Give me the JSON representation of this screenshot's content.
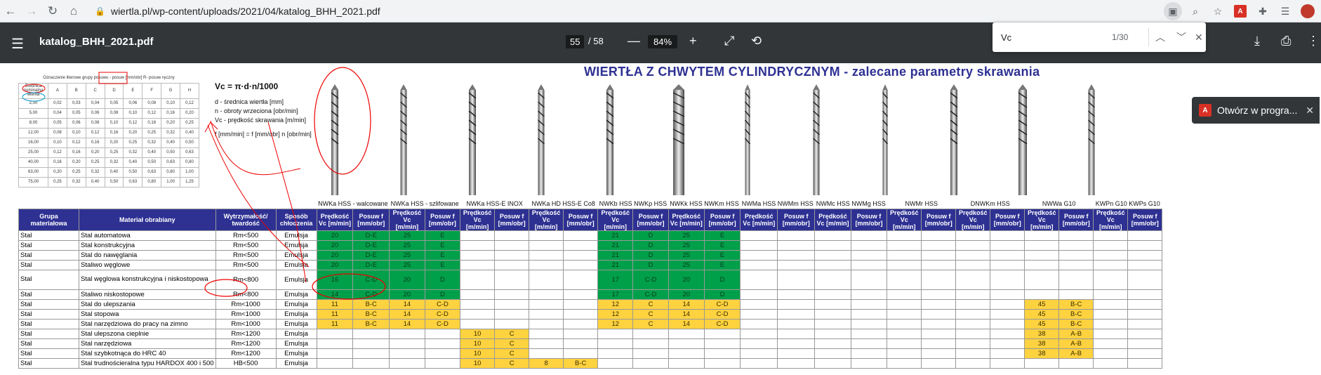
{
  "browser": {
    "url_host": "wiertla.pl",
    "url_path": "/wp-content/uploads/2021/04/katalog_BHH_2021.pdf"
  },
  "viewer": {
    "file_name": "katalog_BHH_2021.pdf",
    "page_current": "55",
    "page_total": "/ 58",
    "zoom": "84%"
  },
  "find": {
    "query": "Vc",
    "count": "1/30"
  },
  "popup": {
    "label": "Otwórz w progra..."
  },
  "doc": {
    "title": "WIERTŁA Z CHWYTEM CYLINDRYCZNYM - zalecane parametry skrawania",
    "mini_table": {
      "caption": "Oznaczenie literowe grupy posuwu - posuw [mm/obr] R- posuw ręczny",
      "head": [
        "Średnica nominalna wiertła",
        "A",
        "B",
        "C",
        "D",
        "E",
        "F",
        "G",
        "H"
      ],
      "rows": [
        [
          "2,00",
          "0,02",
          "0,03",
          "0,04",
          "0,05",
          "0,06",
          "0,08",
          "0,10",
          "0,12"
        ],
        [
          "5,00",
          "0,04",
          "0,05",
          "0,06",
          "0,08",
          "0,10",
          "0,12",
          "0,16",
          "0,20"
        ],
        [
          "8,00",
          "0,05",
          "0,06",
          "0,08",
          "0,10",
          "0,12",
          "0,16",
          "0,20",
          "0,25"
        ],
        [
          "12,00",
          "0,08",
          "0,10",
          "0,12",
          "0,16",
          "0,20",
          "0,25",
          "0,32",
          "0,40"
        ],
        [
          "16,00",
          "0,10",
          "0,12",
          "0,16",
          "0,20",
          "0,25",
          "0,32",
          "0,40",
          "0,50"
        ],
        [
          "25,00",
          "0,12",
          "0,16",
          "0,20",
          "0,25",
          "0,32",
          "0,40",
          "0,50",
          "0,63"
        ],
        [
          "40,00",
          "0,16",
          "0,20",
          "0,25",
          "0,32",
          "0,40",
          "0,50",
          "0,63",
          "0,80"
        ],
        [
          "63,00",
          "0,20",
          "0,25",
          "0,32",
          "0,40",
          "0,50",
          "0,63",
          "0,80",
          "1,00"
        ],
        [
          "75,00",
          "0,25",
          "0,32",
          "0,40",
          "0,50",
          "0,63",
          "0,80",
          "1,00",
          "1,25"
        ]
      ]
    },
    "formula": {
      "main": "Vc = π·d·n/1000",
      "d": "d - średnica wiertła [mm]",
      "n": "n - obroty wrzeciona [obr/min]",
      "vc": "Vc - prędkość skrawania [m/min]",
      "f": "f [mm/min] = f [mm/obr] n [obr/min]"
    },
    "groups": [
      "NWKa HSS - walcowane",
      "NWKa HSS - szlifowane",
      "NWKa HSS-E INOX",
      "NWKa HD HSS-E Co8",
      "NWKb HSS NWKp HSS",
      "NWKk HSS NWKm HSS",
      "NWMa HSS NWMm HSS",
      "NWMc HSS NWMg HSS",
      "NWMr HSS",
      "DNWKm HSS",
      "NWWa G10",
      "KWPn G10 KWPs G10"
    ],
    "colors": {
      "green": "#00a04a",
      "yellow": "#ffd23f",
      "header": "#2e3192"
    },
    "table": {
      "head": [
        "Grupa materiałowa",
        "Materiał obrabiany",
        "Wytrzymałość/ twardość",
        "Sposób chłodzenia"
      ],
      "v_head": "Prędkość Vc [m/min]",
      "f_head": "Posuw f [mm/obr]",
      "rows": [
        {
          "g": "Stal",
          "m": "Stal automatowa",
          "w": "Rm<500",
          "s": "Emulsja",
          "c": {
            "0": [
              "20",
              "D-E"
            ],
            "1": [
              "25",
              "E"
            ],
            "4": [
              "21",
              "D"
            ],
            "5": [
              "25",
              "E"
            ]
          },
          "col": "g"
        },
        {
          "g": "Stal",
          "m": "Stal konstrukcyjna",
          "w": "Rm<500",
          "s": "Emulsja",
          "c": {
            "0": [
              "20",
              "D-E"
            ],
            "1": [
              "25",
              "E"
            ],
            "4": [
              "21",
              "D"
            ],
            "5": [
              "25",
              "E"
            ]
          },
          "col": "g"
        },
        {
          "g": "Stal",
          "m": "Stal do nawęglania",
          "w": "Rm<500",
          "s": "Emulsja",
          "c": {
            "0": [
              "20",
              "D-E"
            ],
            "1": [
              "25",
              "E"
            ],
            "4": [
              "21",
              "D"
            ],
            "5": [
              "25",
              "E"
            ]
          },
          "col": "g"
        },
        {
          "g": "Stal",
          "m": "Staliwo węglowe",
          "w": "Rm<500",
          "s": "Emulsja",
          "c": {
            "0": [
              "20",
              "D-E"
            ],
            "1": [
              "25",
              "E"
            ],
            "4": [
              "21",
              "D"
            ],
            "5": [
              "25",
              "E"
            ]
          },
          "col": "g"
        },
        {
          "g": "Stal",
          "m": "Stal węglowa konstrukcyjna i niskostopowa",
          "w": "Rm<800",
          "s": "Emulsja",
          "c": {
            "0": [
              "16",
              "C-D"
            ],
            "1": [
              "20",
              "D"
            ],
            "4": [
              "17",
              "C-D"
            ],
            "5": [
              "20",
              "D"
            ]
          },
          "col": "g",
          "tall": true
        },
        {
          "g": "Stal",
          "m": "Staliwo niskostopowe",
          "w": "Rm<800",
          "s": "Emulsja",
          "c": {
            "0": [
              "14",
              "C-D"
            ],
            "1": [
              "20",
              "D"
            ],
            "4": [
              "17",
              "C-D"
            ],
            "5": [
              "20",
              "D"
            ]
          },
          "col": "g"
        },
        {
          "g": "Stal",
          "m": "Stal do ulepszania",
          "w": "Rm<1000",
          "s": "Emulsja",
          "c": {
            "0": [
              "11",
              "B-C"
            ],
            "1": [
              "14",
              "C-D"
            ],
            "4": [
              "12",
              "C"
            ],
            "5": [
              "14",
              "C-D"
            ],
            "10": [
              "45",
              "B-C"
            ]
          },
          "col": "y"
        },
        {
          "g": "Stal",
          "m": "Stal stopowa",
          "w": "Rm<1000",
          "s": "Emulsja",
          "c": {
            "0": [
              "11",
              "B-C"
            ],
            "1": [
              "14",
              "C-D"
            ],
            "4": [
              "12",
              "C"
            ],
            "5": [
              "14",
              "C-D"
            ],
            "10": [
              "45",
              "B-C"
            ]
          },
          "col": "y"
        },
        {
          "g": "Stal",
          "m": "Stal narzędziowa do pracy na zimno",
          "w": "Rm<1000",
          "s": "Emulsja",
          "c": {
            "0": [
              "11",
              "B-C"
            ],
            "1": [
              "14",
              "C-D"
            ],
            "4": [
              "12",
              "C"
            ],
            "5": [
              "14",
              "C-D"
            ],
            "10": [
              "45",
              "B-C"
            ]
          },
          "col": "y"
        },
        {
          "g": "Stal",
          "m": "Stal ulepszona cieplnie",
          "w": "Rm<1200",
          "s": "Emulsja",
          "c": {
            "2": [
              "10",
              "C"
            ],
            "10": [
              "38",
              "A-B"
            ]
          },
          "col": "y"
        },
        {
          "g": "Stal",
          "m": "Stal narzędziowa",
          "w": "Rm<1200",
          "s": "Emulsja",
          "c": {
            "2": [
              "10",
              "C"
            ],
            "10": [
              "38",
              "A-B"
            ]
          },
          "col": "y"
        },
        {
          "g": "Stal",
          "m": "Stal szybkotnąca do HRC 40",
          "w": "Rm<1200",
          "s": "Emulsja",
          "c": {
            "2": [
              "10",
              "C"
            ],
            "10": [
              "38",
              "A-B"
            ]
          },
          "col": "y"
        },
        {
          "g": "Stal",
          "m": "Stal trudnościeralna typu HARDOX 400 i 500",
          "w": "HB<500",
          "s": "Emulsja",
          "c": {
            "2": [
              "10",
              "C"
            ],
            "3": [
              "8",
              "B-C"
            ]
          },
          "col": "y"
        }
      ]
    }
  }
}
